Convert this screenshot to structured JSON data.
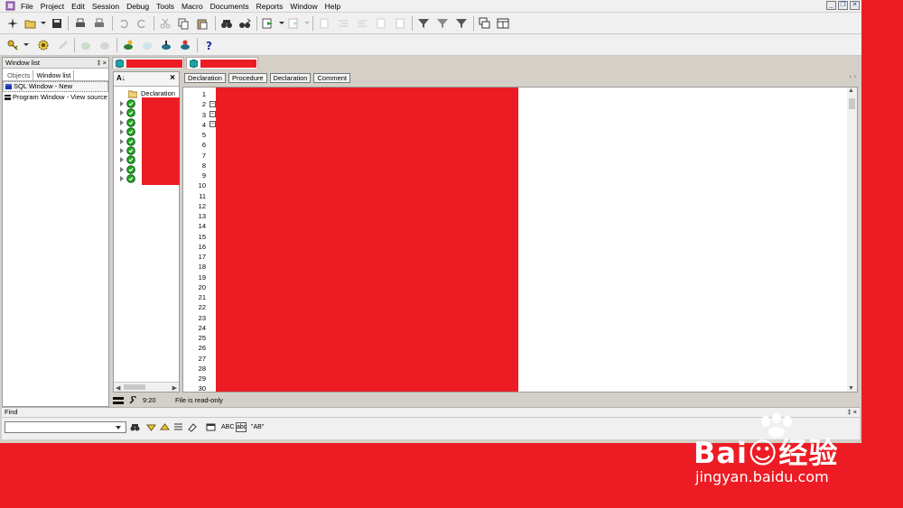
{
  "menu": {
    "items": [
      "File",
      "Project",
      "Edit",
      "Session",
      "Debug",
      "Tools",
      "Macro",
      "Documents",
      "Reports",
      "Window",
      "Help"
    ]
  },
  "window_list": {
    "title": "Window list",
    "pin_close": "‡ ×",
    "tabs": [
      "Objects",
      "Window list"
    ],
    "items": [
      "SQL Window - New",
      "Program Window - View source of"
    ]
  },
  "tree": {
    "sort_label": "A↓",
    "close": "×",
    "root_label": "Declaration"
  },
  "filter_buttons": [
    "Declaration",
    "Procedure",
    "Declaration",
    "Comment"
  ],
  "filter_nav": "‹ ›",
  "editor": {
    "line_numbers": [
      "1",
      "2",
      "3",
      "4",
      "5",
      "6",
      "7",
      "8",
      "9",
      "10",
      "11",
      "12",
      "13",
      "14",
      "15",
      "16",
      "17",
      "18",
      "19",
      "20",
      "21",
      "22",
      "23",
      "24",
      "25",
      "26",
      "27",
      "28",
      "29",
      "30"
    ]
  },
  "status": {
    "position": "9:20",
    "message": "File is read-only"
  },
  "find": {
    "title": "Find",
    "pin_close": "‡ ×",
    "input_value": "",
    "tools": [
      "ABC",
      "abc",
      "\"AB\""
    ]
  },
  "watermark": {
    "brand": "Bai☺经验",
    "url": "jingyan.baidu.com"
  },
  "colors": {
    "redaction": "#ed1c24",
    "chrome": "#d4d0c8",
    "toolbar": "#f0f0f0",
    "node_green": "#22a822"
  }
}
